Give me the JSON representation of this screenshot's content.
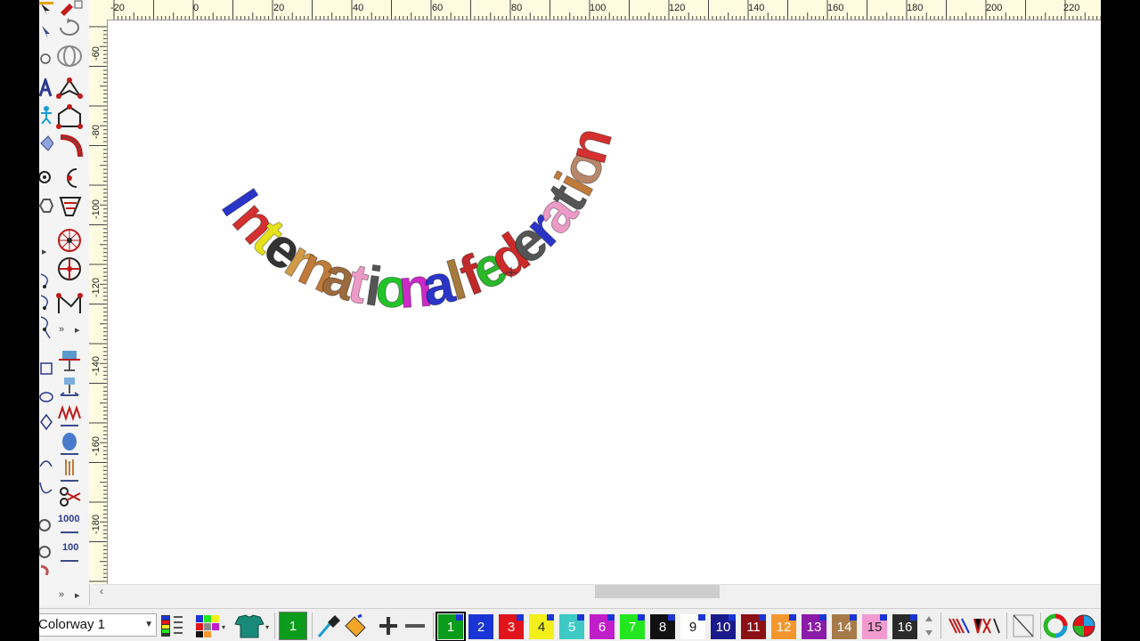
{
  "rulers": {
    "horizontal": [
      "-20",
      "0",
      "20",
      "40",
      "60",
      "80",
      "100",
      "120",
      "140",
      "160",
      "180",
      "200",
      "220"
    ],
    "vertical": [
      "-60",
      "-80",
      "-100",
      "-120",
      "-140",
      "-160",
      "-180"
    ]
  },
  "design": {
    "text": "International federation",
    "letters": [
      {
        "ch": "I",
        "color": "#2a35c8"
      },
      {
        "ch": "n",
        "color": "#d43030"
      },
      {
        "ch": "t",
        "color": "#e6e21a"
      },
      {
        "ch": "e",
        "color": "#333333"
      },
      {
        "ch": "r",
        "color": "#d19a48"
      },
      {
        "ch": "n",
        "color": "#c07a3a"
      },
      {
        "ch": "a",
        "color": "#9c6a3c"
      },
      {
        "ch": "t",
        "color": "#ec9ac8"
      },
      {
        "ch": "i",
        "color": "#555555"
      },
      {
        "ch": "o",
        "color": "#22c42a"
      },
      {
        "ch": "n",
        "color": "#cc2ac8"
      },
      {
        "ch": "a",
        "color": "#2a35c8"
      },
      {
        "ch": "l",
        "color": "#a67a3c"
      },
      {
        "ch": "f",
        "color": "#c02a2a"
      },
      {
        "ch": "e",
        "color": "#2ab82a"
      },
      {
        "ch": "d",
        "color": "#cc2a2a"
      },
      {
        "ch": "e",
        "color": "#555555"
      },
      {
        "ch": "r",
        "color": "#2a35c8"
      },
      {
        "ch": "a",
        "color": "#ec9ac8"
      },
      {
        "ch": "t",
        "color": "#555555"
      },
      {
        "ch": "i",
        "color": "#c07a3a"
      },
      {
        "ch": "o",
        "color": "#b8876a"
      },
      {
        "ch": "n",
        "color": "#d43030"
      }
    ]
  },
  "colorway": {
    "selected": "Colorway 1"
  },
  "current_color": {
    "label": "1",
    "color": "#0a9c1a"
  },
  "palette": [
    {
      "label": "1",
      "color": "#0a9c1a",
      "text": "#ffffff"
    },
    {
      "label": "2",
      "color": "#1a35d6",
      "text": "#ffffff"
    },
    {
      "label": "3",
      "color": "#e0141a",
      "text": "#ffffff"
    },
    {
      "label": "4",
      "color": "#f2ef1a",
      "text": "#222222"
    },
    {
      "label": "5",
      "color": "#3ec9c4",
      "text": "#ffffff"
    },
    {
      "label": "6",
      "color": "#c01ec8",
      "text": "#ffffff"
    },
    {
      "label": "7",
      "color": "#23e61e",
      "text": "#ffffff"
    },
    {
      "label": "8",
      "color": "#111111",
      "text": "#ffffff"
    },
    {
      "label": "9",
      "color": "#ffffff",
      "text": "#111111"
    },
    {
      "label": "10",
      "color": "#1a1a8c",
      "text": "#ffffff"
    },
    {
      "label": "11",
      "color": "#8c0f14",
      "text": "#ffffff"
    },
    {
      "label": "12",
      "color": "#f4962e",
      "text": "#ffffff"
    },
    {
      "label": "13",
      "color": "#8a1aa8",
      "text": "#ffffff"
    },
    {
      "label": "14",
      "color": "#a67a48",
      "text": "#ffffff"
    },
    {
      "label": "15",
      "color": "#f29ad0",
      "text": "#222222"
    },
    {
      "label": "16",
      "color": "#2a2a2a",
      "text": "#ffffff"
    }
  ],
  "icons": {
    "left_toolbar": [
      "select-arrow-icon",
      "reshape-icon",
      "lettering-icon",
      "figure-icon",
      "diamond-icon",
      "circle-target-icon",
      "hexagon-icon",
      "node-edit-icon",
      "path-icon",
      "column-icon",
      "manual-stitch-icon",
      "curve-icon",
      "loop-icon",
      "rotate-icon"
    ],
    "bottom_toolbar": [
      "color-palette-icon",
      "color-grid-icon",
      "shirt-icon",
      "eyedropper-icon",
      "paint-bucket-icon",
      "add-color-icon",
      "remove-color-icon",
      "scroll-arrows-icon",
      "stitch-view-icon",
      "grid-icon",
      "colorwheel-icon",
      "globe-icon"
    ]
  },
  "more_indicators": [
    "»",
    "»",
    "»"
  ]
}
